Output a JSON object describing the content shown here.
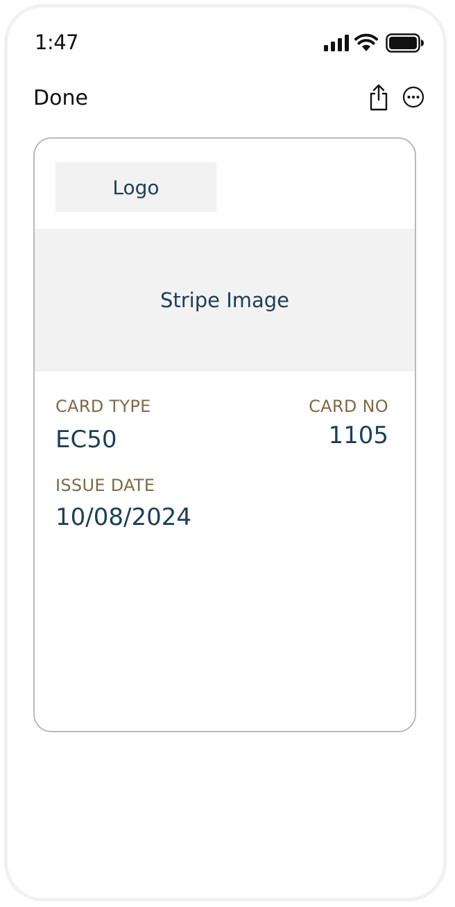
{
  "status_bar": {
    "time": "1:47",
    "icons": [
      "signal-icon",
      "wifi-icon",
      "battery-icon"
    ]
  },
  "nav": {
    "done_label": "Done",
    "actions": [
      "share-icon",
      "more-icon"
    ]
  },
  "card": {
    "logo_placeholder": "Logo",
    "stripe_placeholder": "Stripe Image",
    "fields": {
      "card_type": {
        "label": "CARD TYPE",
        "value": "EC50"
      },
      "card_no": {
        "label": "CARD NO",
        "value": "1105"
      },
      "issue_date": {
        "label": "ISSUE DATE",
        "value": "10/08/2024"
      }
    }
  },
  "colors": {
    "label": "#7d6a45",
    "value": "#1b3f57",
    "placeholder_bg": "#f2f2f2",
    "card_border": "#b9b9b9"
  }
}
